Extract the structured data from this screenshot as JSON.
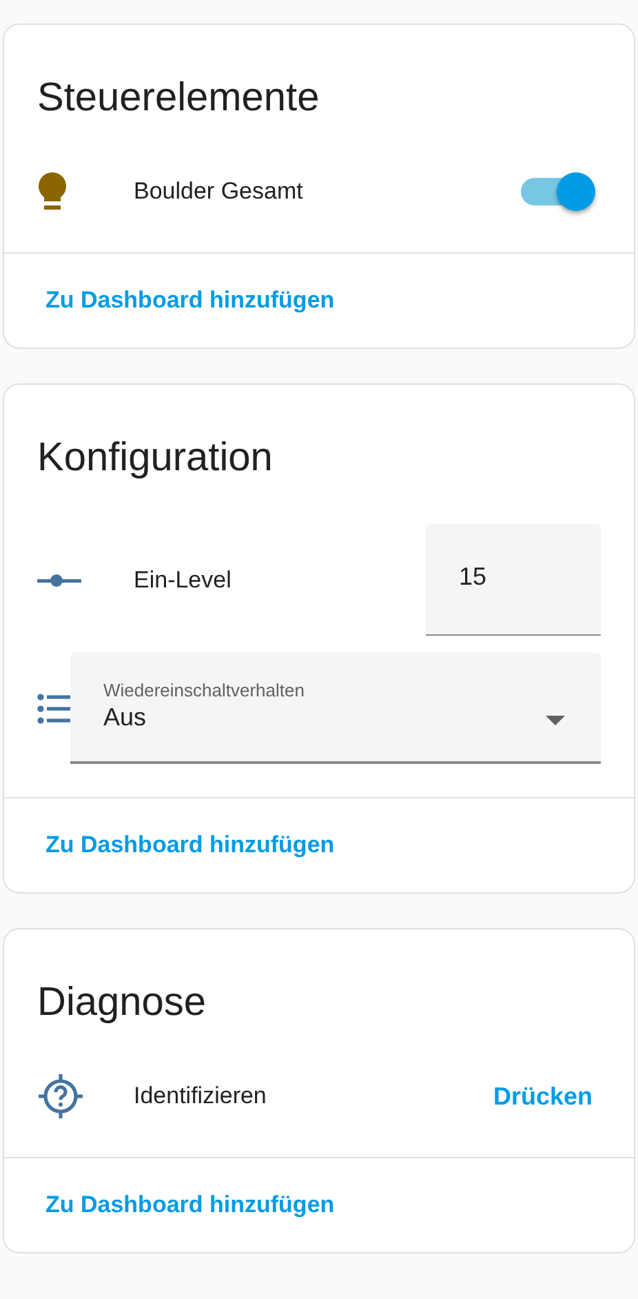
{
  "cards": [
    {
      "title": "Steuerelemente",
      "entities": [
        {
          "kind": "toggle",
          "name": "Boulder Gesamt",
          "on": true
        }
      ],
      "link": "Zu Dashboard hinzufügen"
    },
    {
      "title": "Konfiguration",
      "entities": [
        {
          "kind": "number",
          "name": "Ein-Level",
          "value": "15"
        },
        {
          "kind": "select",
          "label": "Wiedereinschaltverhalten",
          "value": "Aus"
        }
      ],
      "link": "Zu Dashboard hinzufügen"
    },
    {
      "title": "Diagnose",
      "entities": [
        {
          "kind": "button",
          "name": "Identifizieren",
          "action": "Drücken"
        }
      ],
      "link": "Zu Dashboard hinzufügen"
    }
  ]
}
